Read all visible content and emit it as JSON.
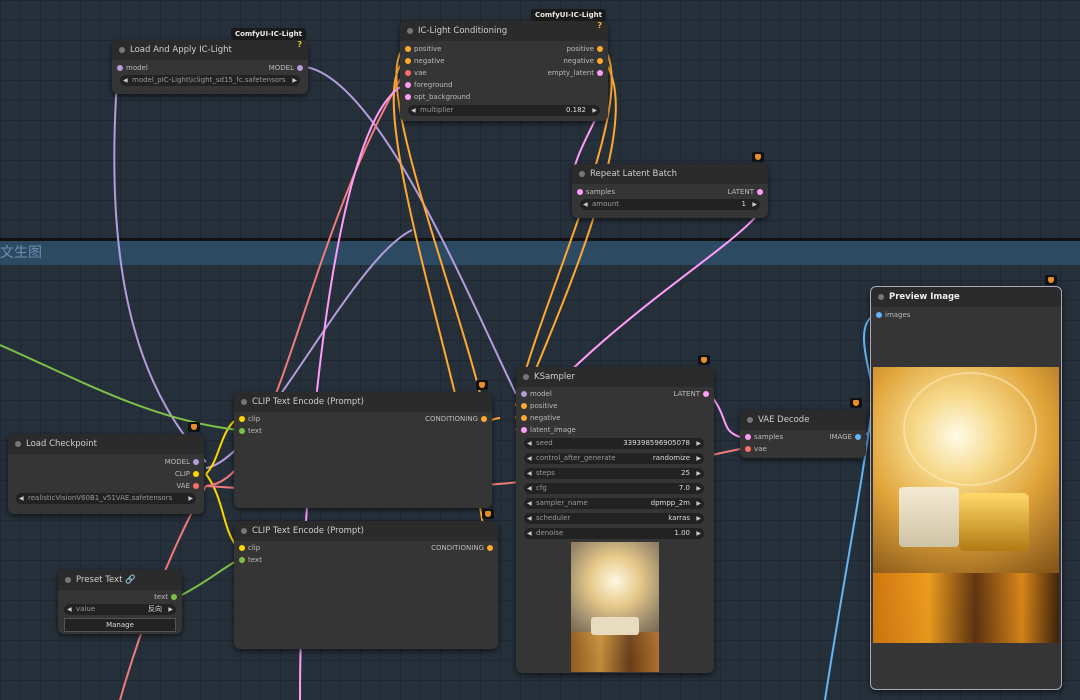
{
  "group": {
    "label": "文生图"
  },
  "badges": {
    "ic_light_a": "ComfyUI-IC-Light",
    "ic_light_b": "ComfyUI-IC-Light"
  },
  "load_ic_light": {
    "title": "Load And Apply IC-Light",
    "help": "?",
    "in_model": "model",
    "out_model": "MODEL",
    "model_path": "model_pIC-Light\\iclight_sd15_fc.safetensors"
  },
  "ic_conditioning": {
    "title": "IC-Light Conditioning",
    "help": "?",
    "inputs": [
      "positive",
      "negative",
      "vae",
      "foreground",
      "opt_background"
    ],
    "outputs": [
      "positive",
      "negative",
      "empty_latent"
    ],
    "multiplier_label": "multiplier",
    "multiplier_value": "0.182"
  },
  "repeat_latent": {
    "title": "Repeat Latent Batch",
    "in_samples": "samples",
    "out_latent": "LATENT",
    "amount_label": "amount",
    "amount_value": "1"
  },
  "load_checkpoint": {
    "title": "Load Checkpoint",
    "outputs": [
      "MODEL",
      "CLIP",
      "VAE"
    ],
    "ckpt_value": "realisticVisionV60B1_v51VAE.safetensors"
  },
  "clip_pos": {
    "title": "CLIP Text Encode (Prompt)",
    "inputs": [
      "clip",
      "text"
    ],
    "output": "CONDITIONING"
  },
  "clip_neg": {
    "title": "CLIP Text Encode (Prompt)",
    "inputs": [
      "clip",
      "text"
    ],
    "output": "CONDITIONING"
  },
  "ksampler": {
    "title": "KSampler",
    "inputs": [
      "model",
      "positive",
      "negative",
      "latent_image"
    ],
    "output": "LATENT",
    "widgets": [
      {
        "label": "seed",
        "value": "339398596905078"
      },
      {
        "label": "control_after_generate",
        "value": "randomize"
      },
      {
        "label": "steps",
        "value": "25"
      },
      {
        "label": "cfg",
        "value": "7.0"
      },
      {
        "label": "sampler_name",
        "value": "dpmpp_2m"
      },
      {
        "label": "scheduler",
        "value": "karras"
      },
      {
        "label": "denoise",
        "value": "1.00"
      }
    ]
  },
  "vae_decode": {
    "title": "VAE Decode",
    "inputs": [
      "samples",
      "vae"
    ],
    "output": "IMAGE"
  },
  "preset_text": {
    "title": "Preset Text",
    "out_text": "text",
    "value_label": "value",
    "value": "反向",
    "manage": "Manage"
  },
  "preview": {
    "title": "Preview Image",
    "in_images": "images"
  },
  "colors": {
    "model": "#b39ddb",
    "clip": "#ffd500",
    "vae": "#ff6e6e",
    "cond": "#ffa931",
    "latent": "#ff9cf9",
    "image": "#64b5f6",
    "string": "#7cc047"
  }
}
